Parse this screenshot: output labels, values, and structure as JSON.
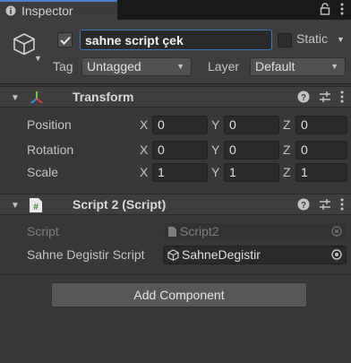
{
  "tab": {
    "title": "Inspector",
    "icon": "info-icon"
  },
  "header": {
    "active": true,
    "object_name": "sahne script çek",
    "static_label": "Static",
    "tag_label": "Tag",
    "tag_value": "Untagged",
    "layer_label": "Layer",
    "layer_value": "Default"
  },
  "transform": {
    "title": "Transform",
    "position": {
      "label": "Position",
      "x": "0",
      "y": "0",
      "z": "0"
    },
    "rotation": {
      "label": "Rotation",
      "x": "0",
      "y": "0",
      "z": "0"
    },
    "scale": {
      "label": "Scale",
      "x": "1",
      "y": "1",
      "z": "1"
    },
    "axis": {
      "x": "X",
      "y": "Y",
      "z": "Z"
    }
  },
  "script_component": {
    "title": "Script 2 (Script)",
    "script_label": "Script",
    "script_value": "Script2",
    "field_label": "Sahne Degistir Script",
    "field_value": "SahneDegistir"
  },
  "add_component_label": "Add Component",
  "colors": {
    "accent": "#4c7ed6",
    "selection_border": "#3a79bb",
    "background": "#383838"
  }
}
